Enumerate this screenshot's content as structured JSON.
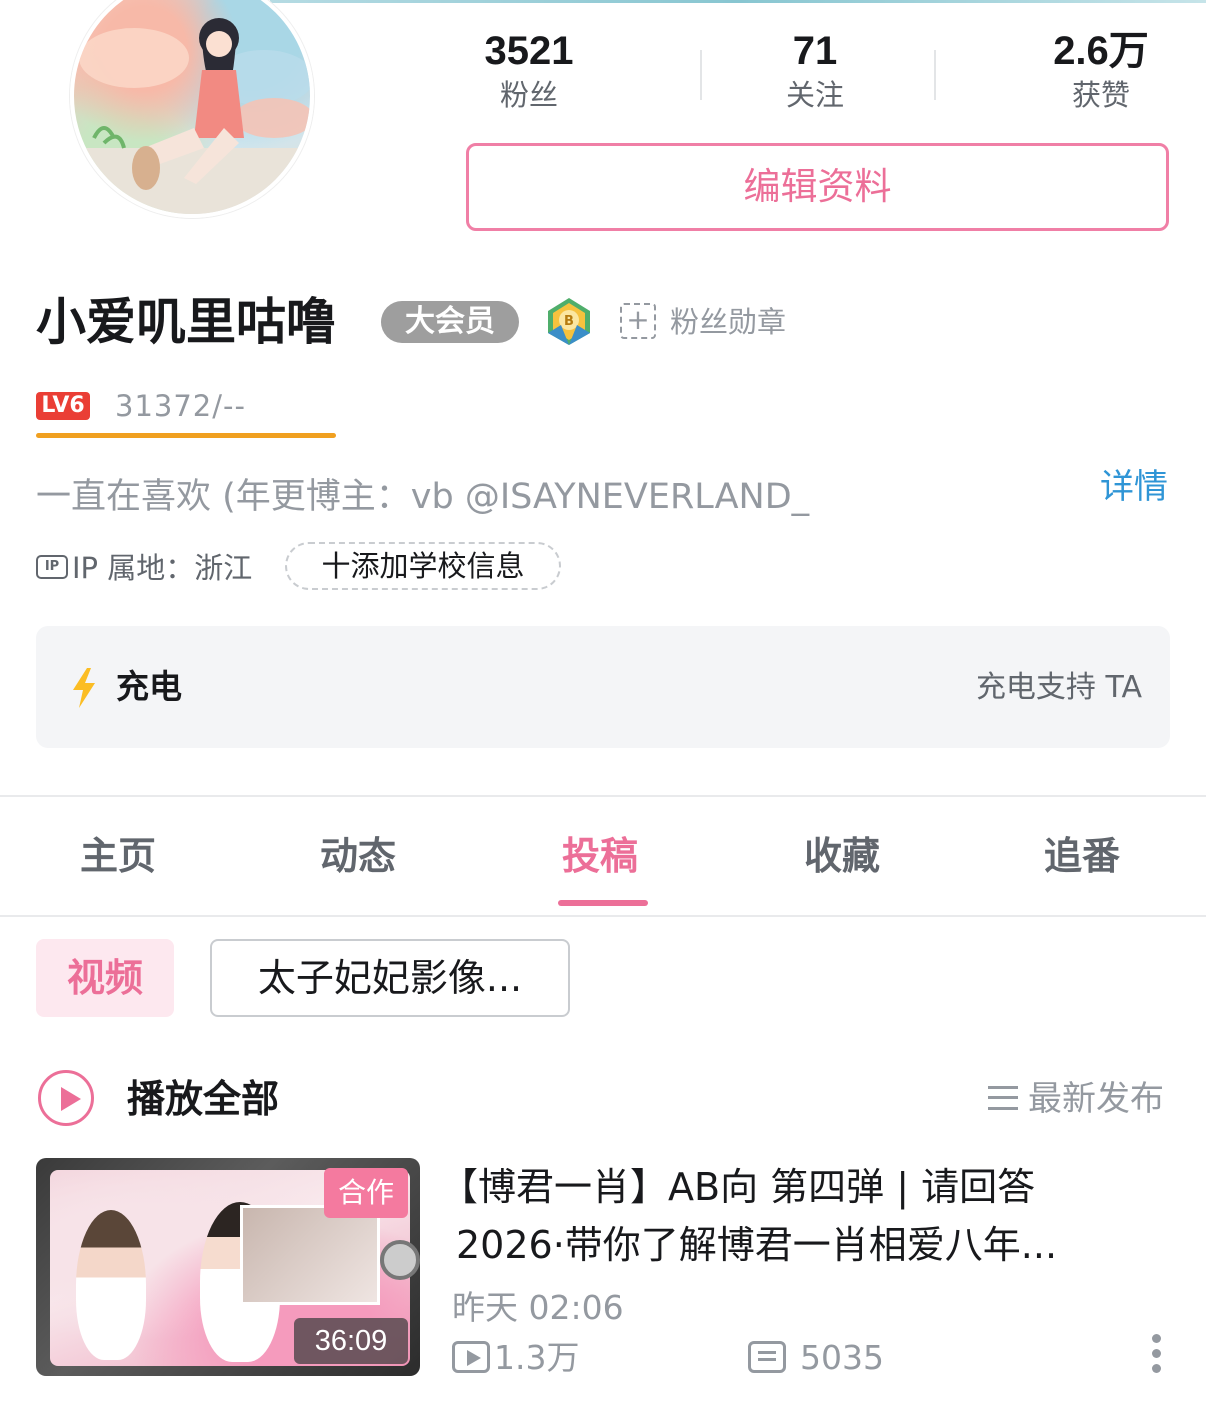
{
  "stats": {
    "fans": {
      "value": "3521",
      "label": "粉丝"
    },
    "following": {
      "value": "71",
      "label": "关注"
    },
    "likes": {
      "value": "2.6万",
      "label": "获赞"
    }
  },
  "edit_profile_label": "编辑资料",
  "user": {
    "name": "小爱叽里咕噜",
    "vip_badge": "大会员",
    "fan_medal_label": "粉丝勋章",
    "level_badge": "LV6",
    "exp_text": "31372/--",
    "bio": "一直在喜欢 (年更博主：vb @ISAYNEVERLAND_",
    "bio_detail_link": "详情",
    "ip_label": "IP 属地：浙江",
    "add_school_label": "十添加学校信息"
  },
  "charge": {
    "title": "充电",
    "action": "充电支持 TA"
  },
  "tabs": [
    {
      "label": "主页",
      "active": false
    },
    {
      "label": "动态",
      "active": false
    },
    {
      "label": "投稿",
      "active": true
    },
    {
      "label": "收藏",
      "active": false
    },
    {
      "label": "追番",
      "active": false
    }
  ],
  "sub_tabs": {
    "video": "视频",
    "series": "太子妃妃影像..."
  },
  "play_all_label": "播放全部",
  "sort_label": "最新发布",
  "videos": [
    {
      "title_line1": "【博君一肖】AB向 第四弹 | 请回答",
      "title_line2": "2026·带你了解博君一肖相爱八年...",
      "collab_tag": "合作",
      "duration": "36:09",
      "date": "昨天 02:06",
      "plays": "1.3万",
      "danmaku": "5035"
    }
  ],
  "colors": {
    "accent_pink": "#ec6f98",
    "link_blue": "#2f95d6",
    "level_red": "#ea3e35",
    "exp_bar_orange": "#f0a020",
    "vip_gray": "#9e9e9e"
  }
}
